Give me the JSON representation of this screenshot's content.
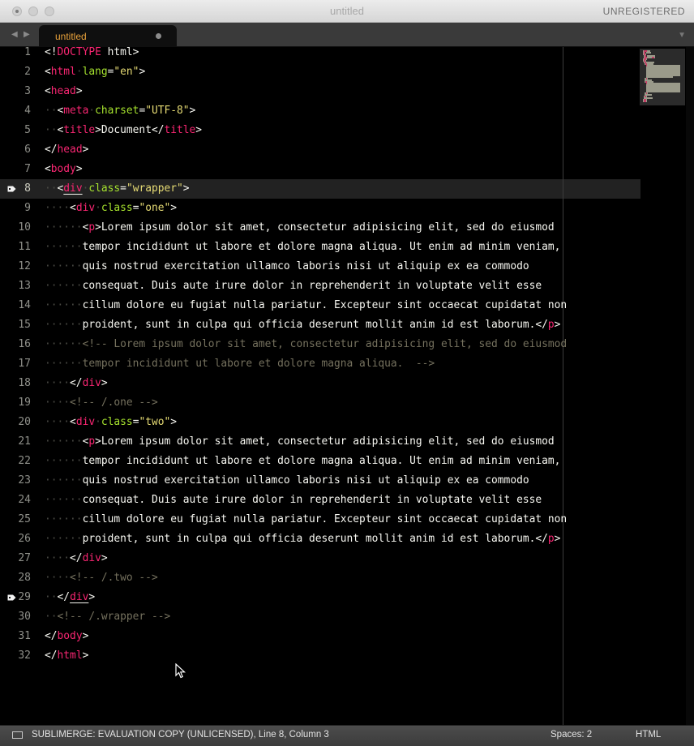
{
  "window": {
    "title": "untitled",
    "registration": "UNREGISTERED"
  },
  "tabbar": {
    "nav_left": "◀",
    "nav_right": "▶",
    "active_tab": "untitled",
    "menu_glyph": "▼"
  },
  "editor": {
    "current_line": 8,
    "bookmarked_lines": [
      8,
      29
    ],
    "lines": [
      {
        "n": "1",
        "tokens": [
          [
            "p",
            "<!"
          ],
          [
            "tag",
            "DOCTYPE"
          ],
          [
            "p",
            " html>"
          ]
        ]
      },
      {
        "n": "2",
        "tokens": [
          [
            "p",
            "<"
          ],
          [
            "tag",
            "html"
          ],
          [
            "ws",
            "·"
          ],
          [
            "attr",
            "lang"
          ],
          [
            "p",
            "="
          ],
          [
            "str",
            "\"en\""
          ],
          [
            "p",
            ">"
          ]
        ]
      },
      {
        "n": "3",
        "tokens": [
          [
            "p",
            "<"
          ],
          [
            "tag",
            "head"
          ],
          [
            "p",
            ">"
          ]
        ]
      },
      {
        "n": "4",
        "tokens": [
          [
            "ws",
            "··"
          ],
          [
            "p",
            "<"
          ],
          [
            "tag",
            "meta"
          ],
          [
            "ws",
            "·"
          ],
          [
            "attr",
            "charset"
          ],
          [
            "p",
            "="
          ],
          [
            "str",
            "\"UTF-8\""
          ],
          [
            "p",
            ">"
          ]
        ]
      },
      {
        "n": "5",
        "tokens": [
          [
            "ws",
            "··"
          ],
          [
            "p",
            "<"
          ],
          [
            "tag",
            "title"
          ],
          [
            "p",
            ">Document</"
          ],
          [
            "tag",
            "title"
          ],
          [
            "p",
            ">"
          ]
        ]
      },
      {
        "n": "6",
        "tokens": [
          [
            "p",
            "</"
          ],
          [
            "tag",
            "head"
          ],
          [
            "p",
            ">"
          ]
        ]
      },
      {
        "n": "7",
        "tokens": [
          [
            "p",
            "<"
          ],
          [
            "tag",
            "body"
          ],
          [
            "p",
            ">"
          ]
        ]
      },
      {
        "n": "8",
        "tokens": [
          [
            "ws",
            "··"
          ],
          [
            "p",
            "<"
          ],
          [
            "tagu",
            "div"
          ],
          [
            "ws",
            "·"
          ],
          [
            "attr",
            "class"
          ],
          [
            "p",
            "="
          ],
          [
            "str",
            "\"wrapper\""
          ],
          [
            "p",
            ">"
          ]
        ]
      },
      {
        "n": "9",
        "tokens": [
          [
            "ws",
            "····"
          ],
          [
            "p",
            "<"
          ],
          [
            "tag",
            "div"
          ],
          [
            "ws",
            "·"
          ],
          [
            "attr",
            "class"
          ],
          [
            "p",
            "="
          ],
          [
            "str",
            "\"one\""
          ],
          [
            "p",
            ">"
          ]
        ]
      },
      {
        "n": "10",
        "tokens": [
          [
            "ws",
            "······"
          ],
          [
            "p",
            "<"
          ],
          [
            "tag",
            "p"
          ],
          [
            "p",
            ">Lorem ipsum dolor sit amet, consectetur adipisicing elit, sed do eiusmod"
          ]
        ]
      },
      {
        "n": "11",
        "tokens": [
          [
            "ws",
            "······"
          ],
          [
            "p",
            "tempor incididunt ut labore et dolore magna aliqua. Ut enim ad minim veniam,"
          ]
        ]
      },
      {
        "n": "12",
        "tokens": [
          [
            "ws",
            "······"
          ],
          [
            "p",
            "quis nostrud exercitation ullamco laboris nisi ut aliquip ex ea commodo"
          ]
        ]
      },
      {
        "n": "13",
        "tokens": [
          [
            "ws",
            "······"
          ],
          [
            "p",
            "consequat. Duis aute irure dolor in reprehenderit in voluptate velit esse"
          ]
        ]
      },
      {
        "n": "14",
        "tokens": [
          [
            "ws",
            "······"
          ],
          [
            "p",
            "cillum dolore eu fugiat nulla pariatur. Excepteur sint occaecat cupidatat non"
          ]
        ]
      },
      {
        "n": "15",
        "tokens": [
          [
            "ws",
            "······"
          ],
          [
            "p",
            "proident, sunt in culpa qui officia deserunt mollit anim id est laborum.</"
          ],
          [
            "tag",
            "p"
          ],
          [
            "p",
            ">"
          ]
        ]
      },
      {
        "n": "16",
        "tokens": [
          [
            "ws",
            "······"
          ],
          [
            "cmt",
            "<!-- Lorem ipsum dolor sit amet, consectetur adipisicing elit, sed do eiusmod"
          ]
        ]
      },
      {
        "n": "17",
        "tokens": [
          [
            "ws",
            "······"
          ],
          [
            "cmt",
            "tempor incididunt ut labore et dolore magna aliqua.  -->"
          ]
        ]
      },
      {
        "n": "18",
        "tokens": [
          [
            "ws",
            "····"
          ],
          [
            "p",
            "</"
          ],
          [
            "tag",
            "div"
          ],
          [
            "p",
            ">"
          ]
        ]
      },
      {
        "n": "19",
        "tokens": [
          [
            "ws",
            "····"
          ],
          [
            "cmt",
            "<!-- /.one -->"
          ]
        ]
      },
      {
        "n": "20",
        "tokens": [
          [
            "ws",
            "····"
          ],
          [
            "p",
            "<"
          ],
          [
            "tag",
            "div"
          ],
          [
            "ws",
            "·"
          ],
          [
            "attr",
            "class"
          ],
          [
            "p",
            "="
          ],
          [
            "str",
            "\"two\""
          ],
          [
            "p",
            ">"
          ]
        ]
      },
      {
        "n": "21",
        "tokens": [
          [
            "ws",
            "······"
          ],
          [
            "p",
            "<"
          ],
          [
            "tag",
            "p"
          ],
          [
            "p",
            ">Lorem ipsum dolor sit amet, consectetur adipisicing elit, sed do eiusmod"
          ]
        ]
      },
      {
        "n": "22",
        "tokens": [
          [
            "ws",
            "······"
          ],
          [
            "p",
            "tempor incididunt ut labore et dolore magna aliqua. Ut enim ad minim veniam,"
          ]
        ]
      },
      {
        "n": "23",
        "tokens": [
          [
            "ws",
            "······"
          ],
          [
            "p",
            "quis nostrud exercitation ullamco laboris nisi ut aliquip ex ea commodo"
          ]
        ]
      },
      {
        "n": "24",
        "tokens": [
          [
            "ws",
            "······"
          ],
          [
            "p",
            "consequat. Duis aute irure dolor in reprehenderit in voluptate velit esse"
          ]
        ]
      },
      {
        "n": "25",
        "tokens": [
          [
            "ws",
            "······"
          ],
          [
            "p",
            "cillum dolore eu fugiat nulla pariatur. Excepteur sint occaecat cupidatat non"
          ]
        ]
      },
      {
        "n": "26",
        "tokens": [
          [
            "ws",
            "······"
          ],
          [
            "p",
            "proident, sunt in culpa qui officia deserunt mollit anim id est laborum.</"
          ],
          [
            "tag",
            "p"
          ],
          [
            "p",
            ">"
          ]
        ]
      },
      {
        "n": "27",
        "tokens": [
          [
            "ws",
            "····"
          ],
          [
            "p",
            "</"
          ],
          [
            "tag",
            "div"
          ],
          [
            "p",
            ">"
          ]
        ]
      },
      {
        "n": "28",
        "tokens": [
          [
            "ws",
            "····"
          ],
          [
            "cmt",
            "<!-- /.two -->"
          ]
        ]
      },
      {
        "n": "29",
        "tokens": [
          [
            "ws",
            "··"
          ],
          [
            "p",
            "</"
          ],
          [
            "tagu",
            "div"
          ],
          [
            "p",
            ">"
          ]
        ]
      },
      {
        "n": "30",
        "tokens": [
          [
            "ws",
            "··"
          ],
          [
            "cmt",
            "<!-- /.wrapper -->"
          ]
        ]
      },
      {
        "n": "31",
        "tokens": [
          [
            "p",
            "</"
          ],
          [
            "tag",
            "body"
          ],
          [
            "p",
            ">"
          ]
        ]
      },
      {
        "n": "32",
        "tokens": [
          [
            "p",
            "</"
          ],
          [
            "tag",
            "html"
          ],
          [
            "p",
            ">"
          ]
        ]
      }
    ]
  },
  "statusbar": {
    "text": "SUBLIMERGE: EVALUATION COPY (UNLICENSED), Line 8, Column 3",
    "spaces": "Spaces: 2",
    "syntax": "HTML"
  },
  "colors": {
    "tag": "#f92672",
    "attribute": "#a6e22e",
    "string": "#e6db74",
    "comment": "#75715e",
    "tab_label": "#e9a23b"
  }
}
